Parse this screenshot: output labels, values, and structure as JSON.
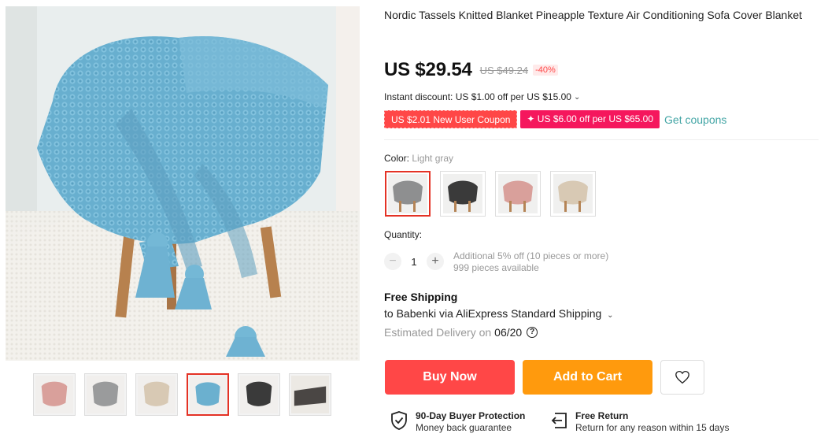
{
  "product": {
    "title": "Nordic Tassels Knitted Blanket Pineapple Texture Air Conditioning Sofa Cover Blanket"
  },
  "price": {
    "current": "US $29.54",
    "original": "US $49.24",
    "discount": "-40%"
  },
  "instant_discount": "Instant discount: US $1.00 off per US $15.00",
  "coupons": {
    "new_user": "US $2.01 New User Coupon",
    "store": "✦ US $6.00 off per US $65.00",
    "get_link": "Get coupons"
  },
  "color": {
    "label": "Color:",
    "selected": "Light gray",
    "options": [
      {
        "name": "gray",
        "hex": "#8e8f90"
      },
      {
        "name": "black",
        "hex": "#3a3a3a"
      },
      {
        "name": "pink",
        "hex": "#d9a09b"
      },
      {
        "name": "beige",
        "hex": "#d8c9b4"
      }
    ]
  },
  "quantity": {
    "label": "Quantity:",
    "value": "1",
    "additional": "Additional 5% off (10 pieces or more)",
    "available": "999 pieces available"
  },
  "shipping": {
    "title": "Free Shipping",
    "via": "to Babenki via AliExpress Standard Shipping",
    "estimated_label": "Estimated Delivery on",
    "estimated_date": "06/20"
  },
  "actions": {
    "buy_now": "Buy Now",
    "add_to_cart": "Add to Cart"
  },
  "guarantees": [
    {
      "title": "90-Day Buyer Protection",
      "subtitle": "Money back guarantee"
    },
    {
      "title": "Free Return",
      "subtitle": "Return for any reason within 15 days"
    }
  ],
  "gallery": {
    "thumbnails": [
      {
        "name": "pink",
        "hex": "#d9a09b"
      },
      {
        "name": "gray",
        "hex": "#9a9b9c"
      },
      {
        "name": "beige",
        "hex": "#d8c9b4"
      },
      {
        "name": "blue",
        "hex": "#6bb0cf"
      },
      {
        "name": "black",
        "hex": "#3a3a3a"
      },
      {
        "name": "dark-gray",
        "hex": "#4a4644"
      }
    ],
    "active_index": 3
  },
  "colors": {
    "accent_red": "#ff4747",
    "accent_orange": "#ff9a0d",
    "coupon_pink": "#f5175d",
    "link_teal": "#42a5a5"
  }
}
